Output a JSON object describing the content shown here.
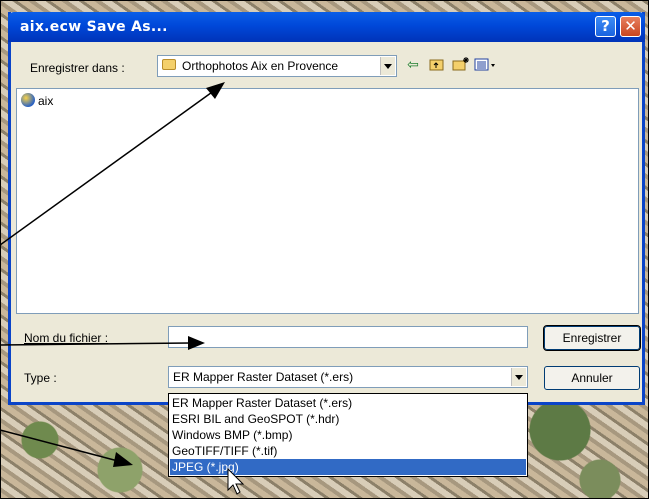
{
  "window": {
    "title": "aix.ecw Save As...",
    "help_glyph": "?",
    "close_glyph": "✕"
  },
  "save_in": {
    "label": "Enregistrer dans :",
    "value": "Orthophotos Aix en Provence"
  },
  "toolbar": {
    "back_icon": "back-arrow-icon",
    "up_icon": "up-folder-icon",
    "new_folder_icon": "new-folder-icon",
    "views_icon": "views-menu-icon"
  },
  "files": [
    {
      "name": "aix",
      "icon": "ecw-globe-icon"
    }
  ],
  "filename": {
    "label": "Nom du fichier :",
    "value": ""
  },
  "filetype": {
    "label": "Type :",
    "selected": "ER Mapper Raster Dataset (*.ers)",
    "options": [
      "ER Mapper Raster Dataset (*.ers)",
      "ESRI BIL and GeoSPOT  (*.hdr)",
      "Windows BMP  (*.bmp)",
      "GeoTIFF/TIFF  (*.tif)",
      "JPEG  (*.jpg)"
    ],
    "highlighted_index": 4
  },
  "buttons": {
    "save": "Enregistrer",
    "cancel": "Annuler"
  },
  "colors": {
    "titlebar": "#0048d9",
    "highlight": "#316ac5"
  }
}
